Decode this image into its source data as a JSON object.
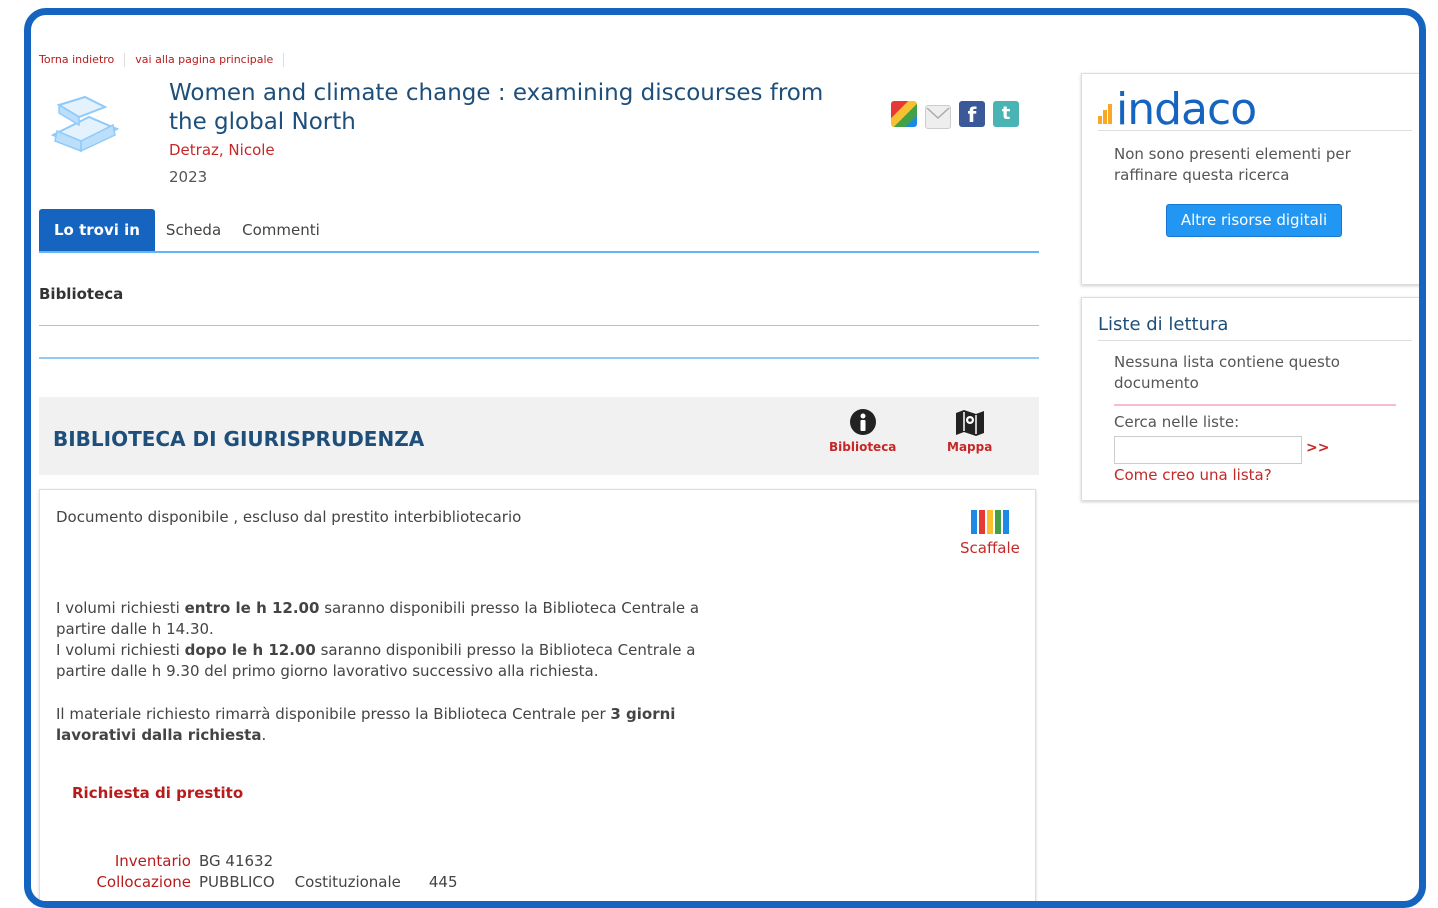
{
  "breadcrumb": {
    "back": "Torna indietro",
    "home": "vai alla pagina principale"
  },
  "record": {
    "title": "Women and climate change : examining discourses from the global North",
    "author": "Detraz, Nicole",
    "year": "2023"
  },
  "share_icons": [
    "google-plus-icon",
    "email-icon",
    "facebook-icon",
    "twitter-icon"
  ],
  "tabs": [
    {
      "label": "Lo trovi in",
      "active": true
    },
    {
      "label": "Scheda",
      "active": false
    },
    {
      "label": "Commenti",
      "active": false
    }
  ],
  "section_label": "Biblioteca",
  "library": {
    "name": "BIBLIOTECA DI GIURISPRUDENZA",
    "info_label": "Biblioteca",
    "map_label": "Mappa"
  },
  "availability": {
    "status": "Documento disponibile , escluso dal prestito interbibliotecario",
    "scaffale_label": "Scaffale",
    "p1_a": "I volumi richiesti ",
    "p1_b": "entro le h 12.00",
    "p1_c": " saranno disponibili presso la Biblioteca Centrale a partire dalle h 14.30.",
    "p2_a": "I volumi richiesti ",
    "p2_b": "dopo le h 12.00",
    "p2_c": " saranno disponibili presso la Biblioteca Centrale a partire dalle h 9.30 del primo giorno lavorativo successivo alla richiesta.",
    "p3_a": "Il materiale richiesto rimarrà disponibile presso la Biblioteca Centrale per ",
    "p3_b": "3 giorni lavorativi dalla richiesta",
    "p3_c": ".",
    "loan_request": "Richiesta di prestito",
    "inventario_label": "Inventario",
    "inventario_value": "BG 41632",
    "collocazione_label": "Collocazione",
    "collocazione_parts": [
      "PUBBLICO",
      "Costituzionale",
      "445"
    ]
  },
  "sidebar": {
    "logo_text": "indaco",
    "no_filters": "Non sono presenti elementi per raffinare questa ricerca",
    "digital_button": "Altre risorse digitali",
    "lists_title": "Liste di lettura",
    "no_lists": "Nessuna lista contiene questo documento",
    "search_label": "Cerca nelle liste:",
    "search_go": ">>",
    "howto_link": "Come creo una lista?"
  }
}
